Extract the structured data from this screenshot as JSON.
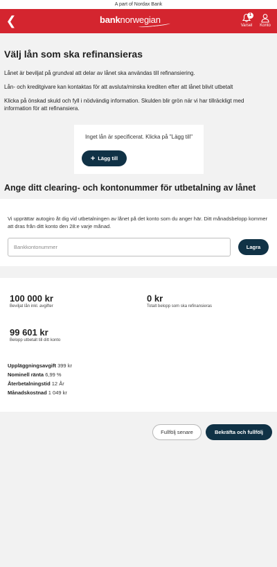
{
  "topbar": {
    "text": "A part of Nordax Bank"
  },
  "header": {
    "logo": {
      "part1": "bank",
      "part2": "norwegian"
    },
    "notifications": {
      "label": "Varsel",
      "count": "1"
    },
    "account": {
      "label": "Konto"
    },
    "brand_color": "#d4252f"
  },
  "refinance": {
    "title": "Välj lån som ska refinansieras",
    "p1": "Lånet är beviljat på grundval att delar av lånet ska användas till refinansiering.",
    "p2": "Lån- och kreditgivare kan kontaktas för att avsluta/minska krediten efter att lånet blivit utbetalt",
    "p3": "Klicka på önskad skuld och fyll i nödvändig information. Skulden blir grön när vi har tillräckligt med information för att refinansiera.",
    "empty_text": "Inget lån är specificerat. Klicka på \"Lägg till\"",
    "add_label": "Lägg till"
  },
  "payout": {
    "title": "Ange ditt clearing- och kontonummer för utbetalning av lånet",
    "info": "Vi upprättar autogiro åt dig vid utbetalningen av lånet på det konto som du anger här. Ditt månadsbelopp kommer att dras från ditt konto den 28:e varje månad.",
    "account_placeholder": "Bankkontonummer",
    "account_value": "",
    "save_label": "Lagra"
  },
  "summary": {
    "granted_amount": "100 000 kr",
    "granted_label": "Beviljat lån inkl. avgifter",
    "refinance_amount": "0 kr",
    "refinance_label": "Totalt belopp som ska refinansieras",
    "payout_amount": "99 601 kr",
    "payout_label": "Belopp utbetalt till ditt konto",
    "details": [
      {
        "label": "Uppläggningsavgift",
        "value": "399 kr"
      },
      {
        "label": "Nominell ränta",
        "value": "6,99 %"
      },
      {
        "label": "Återbetalningstid",
        "value": "12 År"
      },
      {
        "label": "Månadskostnad",
        "value": "1 049 kr"
      }
    ]
  },
  "actions": {
    "later_label": "Fullfölj senare",
    "confirm_label": "Bekräfta och fullfölj"
  },
  "colors": {
    "accent": "#d4252f",
    "dark_button": "#103246",
    "background": "#f2f2f2"
  }
}
